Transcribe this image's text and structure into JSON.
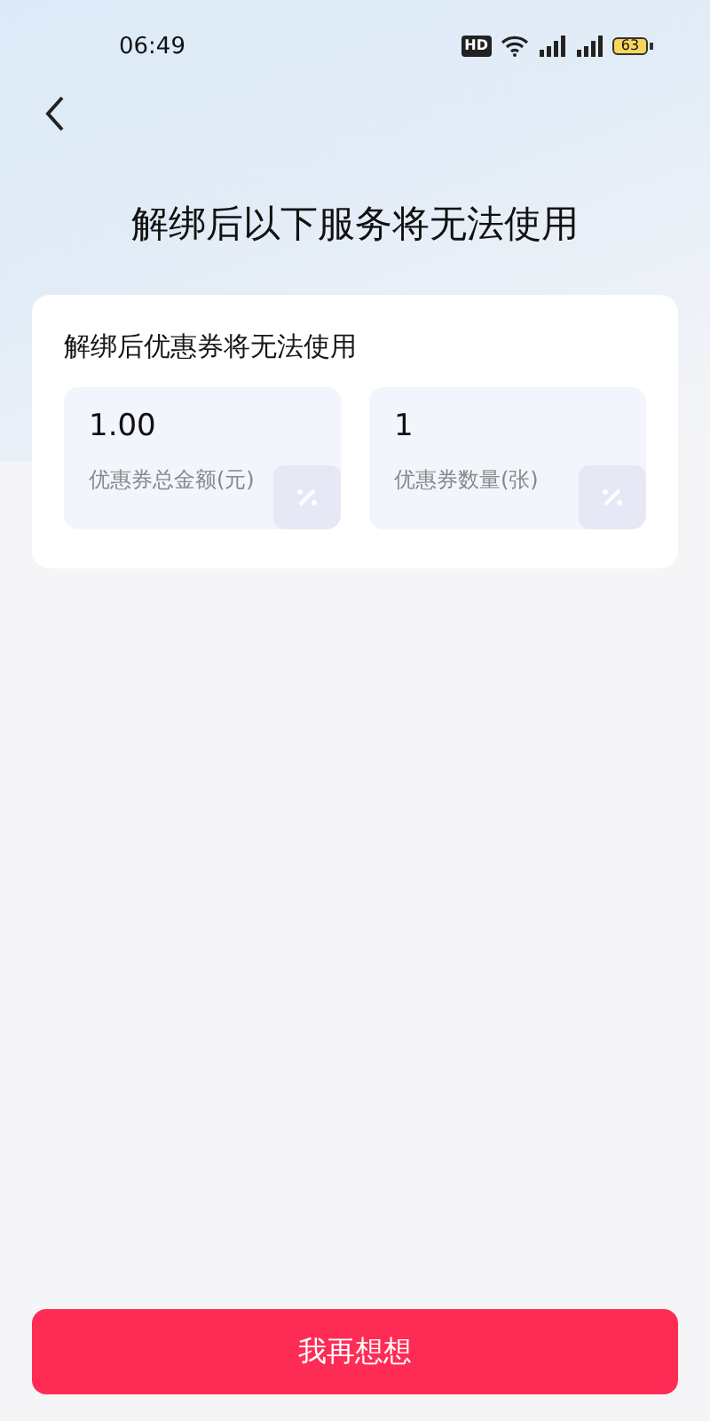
{
  "status_bar": {
    "time": "06:49",
    "hd_label": "HD",
    "battery": "63"
  },
  "title": "解绑后以下服务将无法使用",
  "card": {
    "heading": "解绑后优惠券将无法使用",
    "stats": [
      {
        "value": "1.00",
        "label": "优惠券总金额(元)"
      },
      {
        "value": "1",
        "label": "优惠券数量(张)"
      }
    ]
  },
  "button": "我再想想"
}
